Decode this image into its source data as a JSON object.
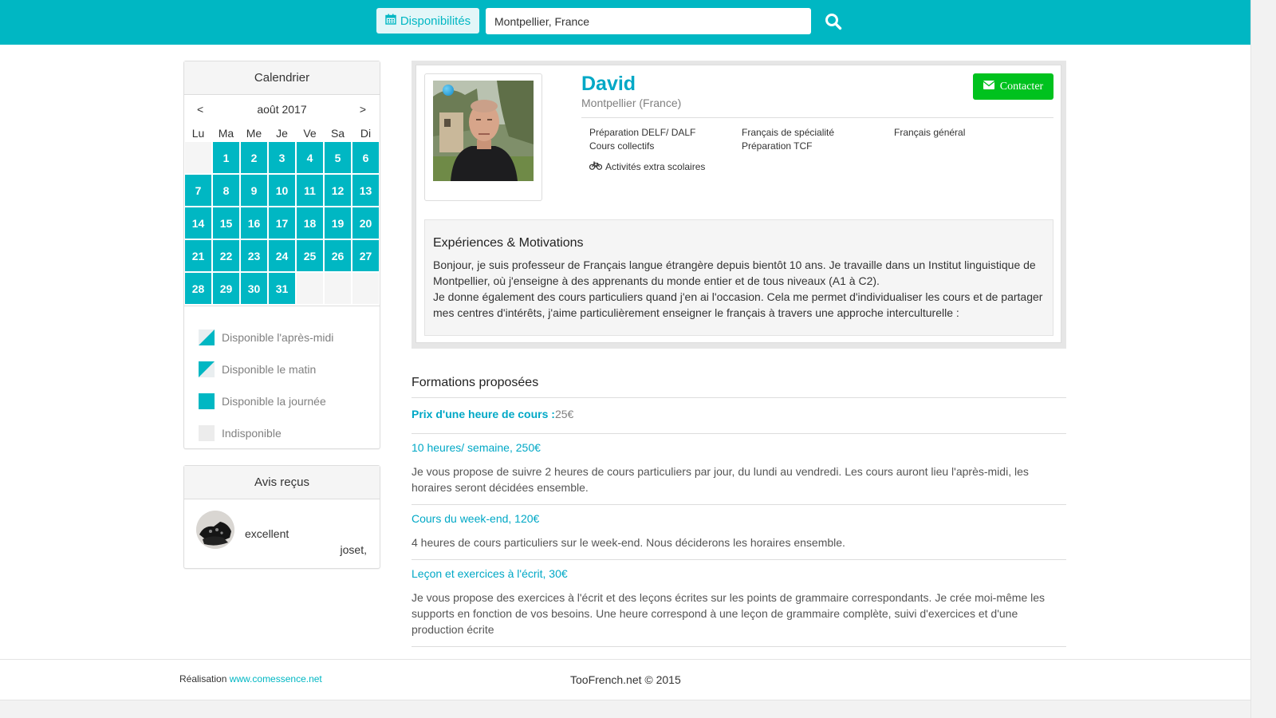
{
  "header": {
    "disponibilites_label": "Disponibilités",
    "search_value": "Montpellier, France"
  },
  "calendar": {
    "title": "Calendrier",
    "prev": "<",
    "next": ">",
    "month": "août 2017",
    "weekdays": [
      "Lu",
      "Ma",
      "Me",
      "Je",
      "Ve",
      "Sa",
      "Di"
    ],
    "days": [
      "",
      "1",
      "2",
      "3",
      "4",
      "5",
      "6",
      "7",
      "8",
      "9",
      "10",
      "11",
      "12",
      "13",
      "14",
      "15",
      "16",
      "17",
      "18",
      "19",
      "20",
      "21",
      "22",
      "23",
      "24",
      "25",
      "26",
      "27",
      "28",
      "29",
      "30",
      "31",
      "",
      "",
      ""
    ],
    "legend": [
      "Disponible l'après-midi",
      "Disponible le matin",
      "Disponible la journée",
      "Indisponible"
    ]
  },
  "reviews": {
    "title": "Avis reçus",
    "items": [
      {
        "text": "excellent",
        "author": "joset,"
      }
    ]
  },
  "profile": {
    "name": "David",
    "location": "Montpellier (France)",
    "contact_label": "Contacter",
    "tags": {
      "col1": [
        "Préparation DELF/ DALF",
        "Cours collectifs"
      ],
      "col2": [
        "Français de spécialité",
        "Préparation TCF"
      ],
      "col3": [
        "Français général"
      ]
    },
    "extra": "Activités extra scolaires",
    "experience_title": "Expériences & Motivations",
    "experience_p1": "Bonjour, je suis professeur de Français langue étrangère depuis bientôt 10 ans. Je travaille dans un Institut linguistique de Montpellier, où j'enseigne à des apprenants du monde entier et de tous niveaux (A1 à C2).",
    "experience_p2": "Je donne également des cours particuliers quand j'en ai l'occasion. Cela me permet d'individualiser les cours et de partager mes centres d'intérêts, j'aime particulièrement enseigner le français à travers une approche interculturelle :"
  },
  "formations": {
    "title": "Formations proposées",
    "price_label": "Prix d'une heure de cours :",
    "price_value": "25€",
    "offers": [
      {
        "title": "10 heures/ semaine, 250€",
        "desc": "Je vous propose de suivre 2 heures de cours particuliers par jour, du lundi au vendredi. Les cours auront lieu l'après-midi, les horaires seront décidées ensemble."
      },
      {
        "title": "Cours du week-end, 120€",
        "desc": "4 heures de cours particuliers sur le week-end. Nous déciderons les horaires ensemble."
      },
      {
        "title": "Leçon et exercices à l'écrit, 30€",
        "desc": "Je vous propose des exercices à l'écrit et des leçons écrites sur les points de grammaire correspondants. Je crée moi-même les supports en fonction de vos besoins. Une heure correspond à une leçon de grammaire complète, suivi d'exercices et d'une production écrite"
      }
    ]
  },
  "footer": {
    "realisation": "Réalisation",
    "link": "www.comessence.net",
    "copyright": "TooFrench.net © 2015"
  },
  "colors": {
    "brand": "#00b7c3",
    "accent_text": "#00a8c6",
    "contact_green": "#00c21e",
    "unavailable": "#f5f5f5"
  },
  "icons": {
    "dispo": "calendar-icon",
    "search": "search-icon",
    "contact": "envelope-icon",
    "extra": "bicycle-icon"
  }
}
